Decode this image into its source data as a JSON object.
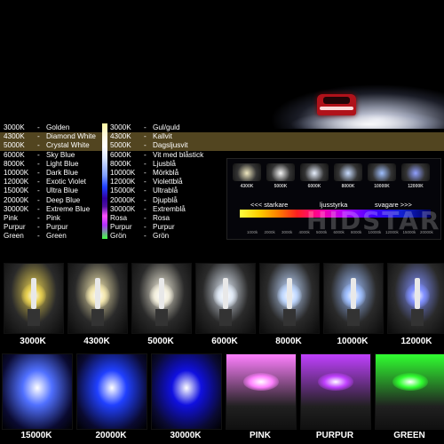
{
  "list_en": [
    {
      "k": "3000K",
      "dash": "-",
      "d": "Golden"
    },
    {
      "k": "4300K",
      "dash": "-",
      "d": "Diamond White"
    },
    {
      "k": "5000K",
      "dash": "-",
      "d": "Crystal White"
    },
    {
      "k": "6000K",
      "dash": "-",
      "d": "Sky Blue"
    },
    {
      "k": "8000K",
      "dash": "-",
      "d": "Light Blue"
    },
    {
      "k": "10000K",
      "dash": "-",
      "d": "Dark Blue"
    },
    {
      "k": "12000K",
      "dash": "-",
      "d": "Exotic Violet"
    },
    {
      "k": "15000K",
      "dash": "-",
      "d": "Ultra Blue"
    },
    {
      "k": "20000K",
      "dash": "-",
      "d": "Deep Blue"
    },
    {
      "k": "30000K",
      "dash": "-",
      "d": "Extreme Blue"
    },
    {
      "k": "Pink",
      "dash": "-",
      "d": "Pink"
    },
    {
      "k": "Purpur",
      "dash": "-",
      "d": "Purpur"
    },
    {
      "k": "Green",
      "dash": "-",
      "d": "Green"
    }
  ],
  "list_sv": [
    {
      "k": "3000K",
      "dash": "-",
      "d": "Gul/guld"
    },
    {
      "k": "4300K",
      "dash": "-",
      "d": "Kallvit"
    },
    {
      "k": "5000K",
      "dash": "-",
      "d": "Dagsljusvit"
    },
    {
      "k": "6000K",
      "dash": "-",
      "d": "Vit med blåstick"
    },
    {
      "k": "8000K",
      "dash": "-",
      "d": "Ljusblå"
    },
    {
      "k": "10000K",
      "dash": "-",
      "d": "Mörkblå"
    },
    {
      "k": "12000K",
      "dash": "-",
      "d": "Violettblå"
    },
    {
      "k": "15000K",
      "dash": "-",
      "d": "Ultrablå"
    },
    {
      "k": "20000K",
      "dash": "-",
      "d": "Djupblå"
    },
    {
      "k": "30000K",
      "dash": "-",
      "d": "Extremblå"
    },
    {
      "k": "Rosa",
      "dash": "-",
      "d": "Rosa"
    },
    {
      "k": "Purpur",
      "dash": "-",
      "d": "Purpur"
    },
    {
      "k": "Grön",
      "dash": "-",
      "d": "Grön"
    }
  ],
  "compare": {
    "labels": [
      "4300K",
      "5000K",
      "6000K",
      "8000K",
      "10000K",
      "12000K"
    ],
    "starkare": "<<< starkare",
    "ljusstyrka": "ljusstyrka",
    "svagare": "svagare >>>",
    "ticks": [
      "1000k",
      "2000k",
      "3000k",
      "4000k",
      "5000k",
      "6000k",
      "8000k",
      "10000k",
      "12000k",
      "15000k",
      "20000k"
    ]
  },
  "watermark": "HIDSTAR",
  "tiles_row1": [
    {
      "label": "3000K",
      "color": "#e8d050"
    },
    {
      "label": "4300K",
      "color": "#f4e8b0"
    },
    {
      "label": "5000K",
      "color": "#f2eedc"
    },
    {
      "label": "6000K",
      "color": "#dfe8f4"
    },
    {
      "label": "8000K",
      "color": "#c0d8ff"
    },
    {
      "label": "10000K",
      "color": "#a0c0ff"
    },
    {
      "label": "12000K",
      "color": "#8090ff"
    }
  ],
  "tiles_row2": [
    {
      "label": "15000K",
      "color": "#5070ff"
    },
    {
      "label": "20000K",
      "color": "#2040ff"
    },
    {
      "label": "30000K",
      "color": "#1010e0"
    },
    {
      "label": "PINK",
      "color": "#ff80ff"
    },
    {
      "label": "PURPUR",
      "color": "#c040ff"
    },
    {
      "label": "GREEN",
      "color": "#30ff30"
    }
  ]
}
